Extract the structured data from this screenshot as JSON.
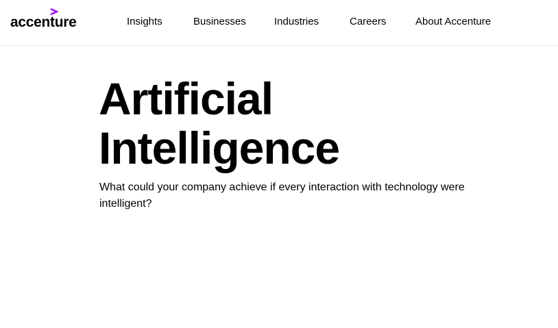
{
  "brand": {
    "logo_text": "accenture",
    "accent_color": "#a100ff"
  },
  "nav": {
    "items": [
      {
        "label": "Insights"
      },
      {
        "label": "Businesses"
      },
      {
        "label": "Industries"
      },
      {
        "label": "Careers"
      },
      {
        "label": "About Accenture"
      }
    ]
  },
  "hero": {
    "title_line1": "Artificial",
    "title_line2": "Intelligence",
    "subtitle": "What could your company achieve if every interaction with technology were intelligent?"
  }
}
